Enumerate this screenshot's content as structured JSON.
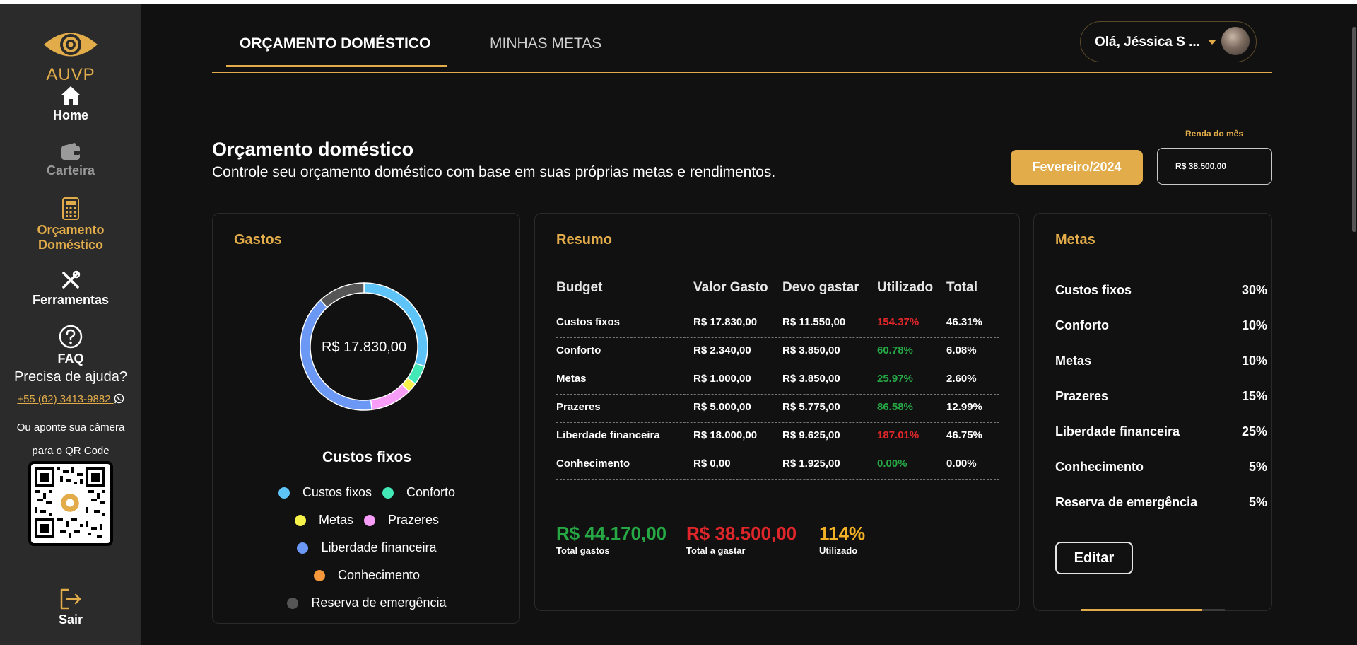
{
  "sidebar": {
    "logo_text": "AUVP",
    "items": [
      {
        "label": "Home"
      },
      {
        "label": "Carteira"
      },
      {
        "label": "Orçamento Doméstico"
      },
      {
        "label": "Ferramentas"
      },
      {
        "label": "FAQ"
      }
    ],
    "help_title": "Precisa de ajuda?",
    "help_phone": "+55 (62) 3413-9882",
    "help_qr_text": "Ou aponte sua câmera para o QR Code",
    "logout_label": "Sair"
  },
  "header": {
    "tabs": [
      {
        "label": "ORÇAMENTO DOMÉSTICO",
        "active": true
      },
      {
        "label": "MINHAS METAS",
        "active": false
      }
    ],
    "user_greeting": "Olá, Jéssica S ..."
  },
  "page": {
    "title": "Orçamento doméstico",
    "subtitle": "Controle seu orçamento doméstico com base em suas próprias metas e rendimentos.",
    "month_button": "Fevereiro/2024",
    "income_label": "Renda do mês",
    "income_value": "R$ 38.500,00"
  },
  "gastos": {
    "title": "Gastos",
    "center_value": "R$ 17.830,00",
    "caption": "Custos fixos",
    "legend": [
      {
        "label": "Custos fixos",
        "color": "#5ec4f7"
      },
      {
        "label": "Conforto",
        "color": "#43e8b7"
      },
      {
        "label": "Metas",
        "color": "#f7f24a"
      },
      {
        "label": "Prazeres",
        "color": "#f79cf7"
      },
      {
        "label": "Liberdade financeira",
        "color": "#6b98f5"
      },
      {
        "label": "Conhecimento",
        "color": "#f5973a"
      },
      {
        "label": "Reserva de emergência",
        "color": "#555555"
      }
    ]
  },
  "chart_data": {
    "type": "pie",
    "donut": true,
    "categories": [
      "Custos fixos",
      "Conforto",
      "Metas",
      "Prazeres",
      "Liberdade financeira",
      "Conhecimento",
      "Reserva de emergência"
    ],
    "values": [
      30,
      5,
      2.5,
      10.5,
      40,
      0,
      12
    ],
    "colors": [
      "#5ec4f7",
      "#43e8b7",
      "#f7f24a",
      "#f79cf7",
      "#6b98f5",
      "#f5973a",
      "#555555"
    ]
  },
  "resumo": {
    "title": "Resumo",
    "headers": [
      "Budget",
      "Valor Gasto",
      "Devo gastar",
      "Utilizado",
      "Total"
    ],
    "rows": [
      {
        "budget": "Custos fixos",
        "gasto": "R$ 17.830,00",
        "devo": "R$ 11.550,00",
        "utilizado": "154.37%",
        "status": "red",
        "total": "46.31%"
      },
      {
        "budget": "Conforto",
        "gasto": "R$ 2.340,00",
        "devo": "R$ 3.850,00",
        "utilizado": "60.78%",
        "status": "green",
        "total": "6.08%"
      },
      {
        "budget": "Metas",
        "gasto": "R$ 1.000,00",
        "devo": "R$ 3.850,00",
        "utilizado": "25.97%",
        "status": "green",
        "total": "2.60%"
      },
      {
        "budget": "Prazeres",
        "gasto": "R$ 5.000,00",
        "devo": "R$ 5.775,00",
        "utilizado": "86.58%",
        "status": "green",
        "total": "12.99%"
      },
      {
        "budget": "Liberdade financeira",
        "gasto": "R$ 18.000,00",
        "devo": "R$ 9.625,00",
        "utilizado": "187.01%",
        "status": "red",
        "total": "46.75%"
      },
      {
        "budget": "Conhecimento",
        "gasto": "R$ 0,00",
        "devo": "R$ 1.925,00",
        "utilizado": "0.00%",
        "status": "green",
        "total": "0.00%"
      }
    ],
    "total_gastos": "R$ 44.170,00",
    "total_gastos_label": "Total gastos",
    "total_a_gastar": "R$ 38.500,00",
    "total_a_gastar_label": "Total a gastar",
    "utilizado": "114%",
    "utilizado_label": "Utilizado"
  },
  "metas": {
    "title": "Metas",
    "items": [
      {
        "label": "Custos fixos",
        "pct": "30%"
      },
      {
        "label": "Conforto",
        "pct": "10%"
      },
      {
        "label": "Metas",
        "pct": "10%"
      },
      {
        "label": "Prazeres",
        "pct": "15%"
      },
      {
        "label": "Liberdade financeira",
        "pct": "25%"
      },
      {
        "label": "Conhecimento",
        "pct": "5%"
      },
      {
        "label": "Reserva de emergência",
        "pct": "5%"
      }
    ],
    "edit_label": "Editar"
  }
}
